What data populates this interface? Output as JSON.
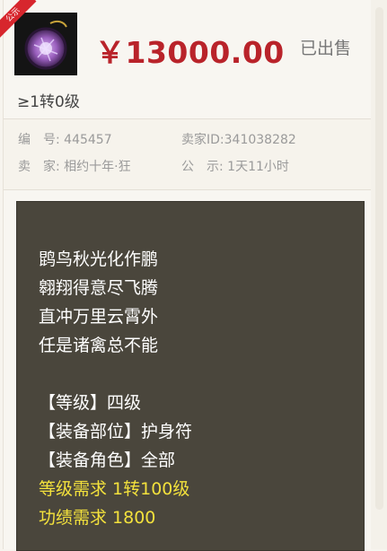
{
  "item": {
    "badge": "公示",
    "icon": "amulet-image",
    "price": "￥13000.00",
    "status": "已出售",
    "level_req_short": "≥1转0级"
  },
  "info": {
    "serial_label": "编　号:",
    "serial_value": "445457",
    "seller_id_label": "卖家ID:",
    "seller_id_value": "341038282",
    "seller_label": "卖　家:",
    "seller_value": "相约十年·狂",
    "notice_label": "公　示:",
    "notice_value": "1天11小时"
  },
  "description": {
    "poem": [
      "鹍鸟秋光化作鹏",
      "翱翔得意尽飞腾",
      "直冲万里云霄外",
      "任是诸禽总不能"
    ],
    "attrs": [
      "【等级】四级",
      "【装备部位】护身符",
      "【装备角色】全部"
    ],
    "requirements": [
      "等级需求 1转100级",
      "功绩需求 1800"
    ]
  },
  "colors": {
    "price": "#b9232a",
    "badge": "#d7262d",
    "panel_bg": "#4a463c",
    "requirement_text": "#f3e13c"
  }
}
